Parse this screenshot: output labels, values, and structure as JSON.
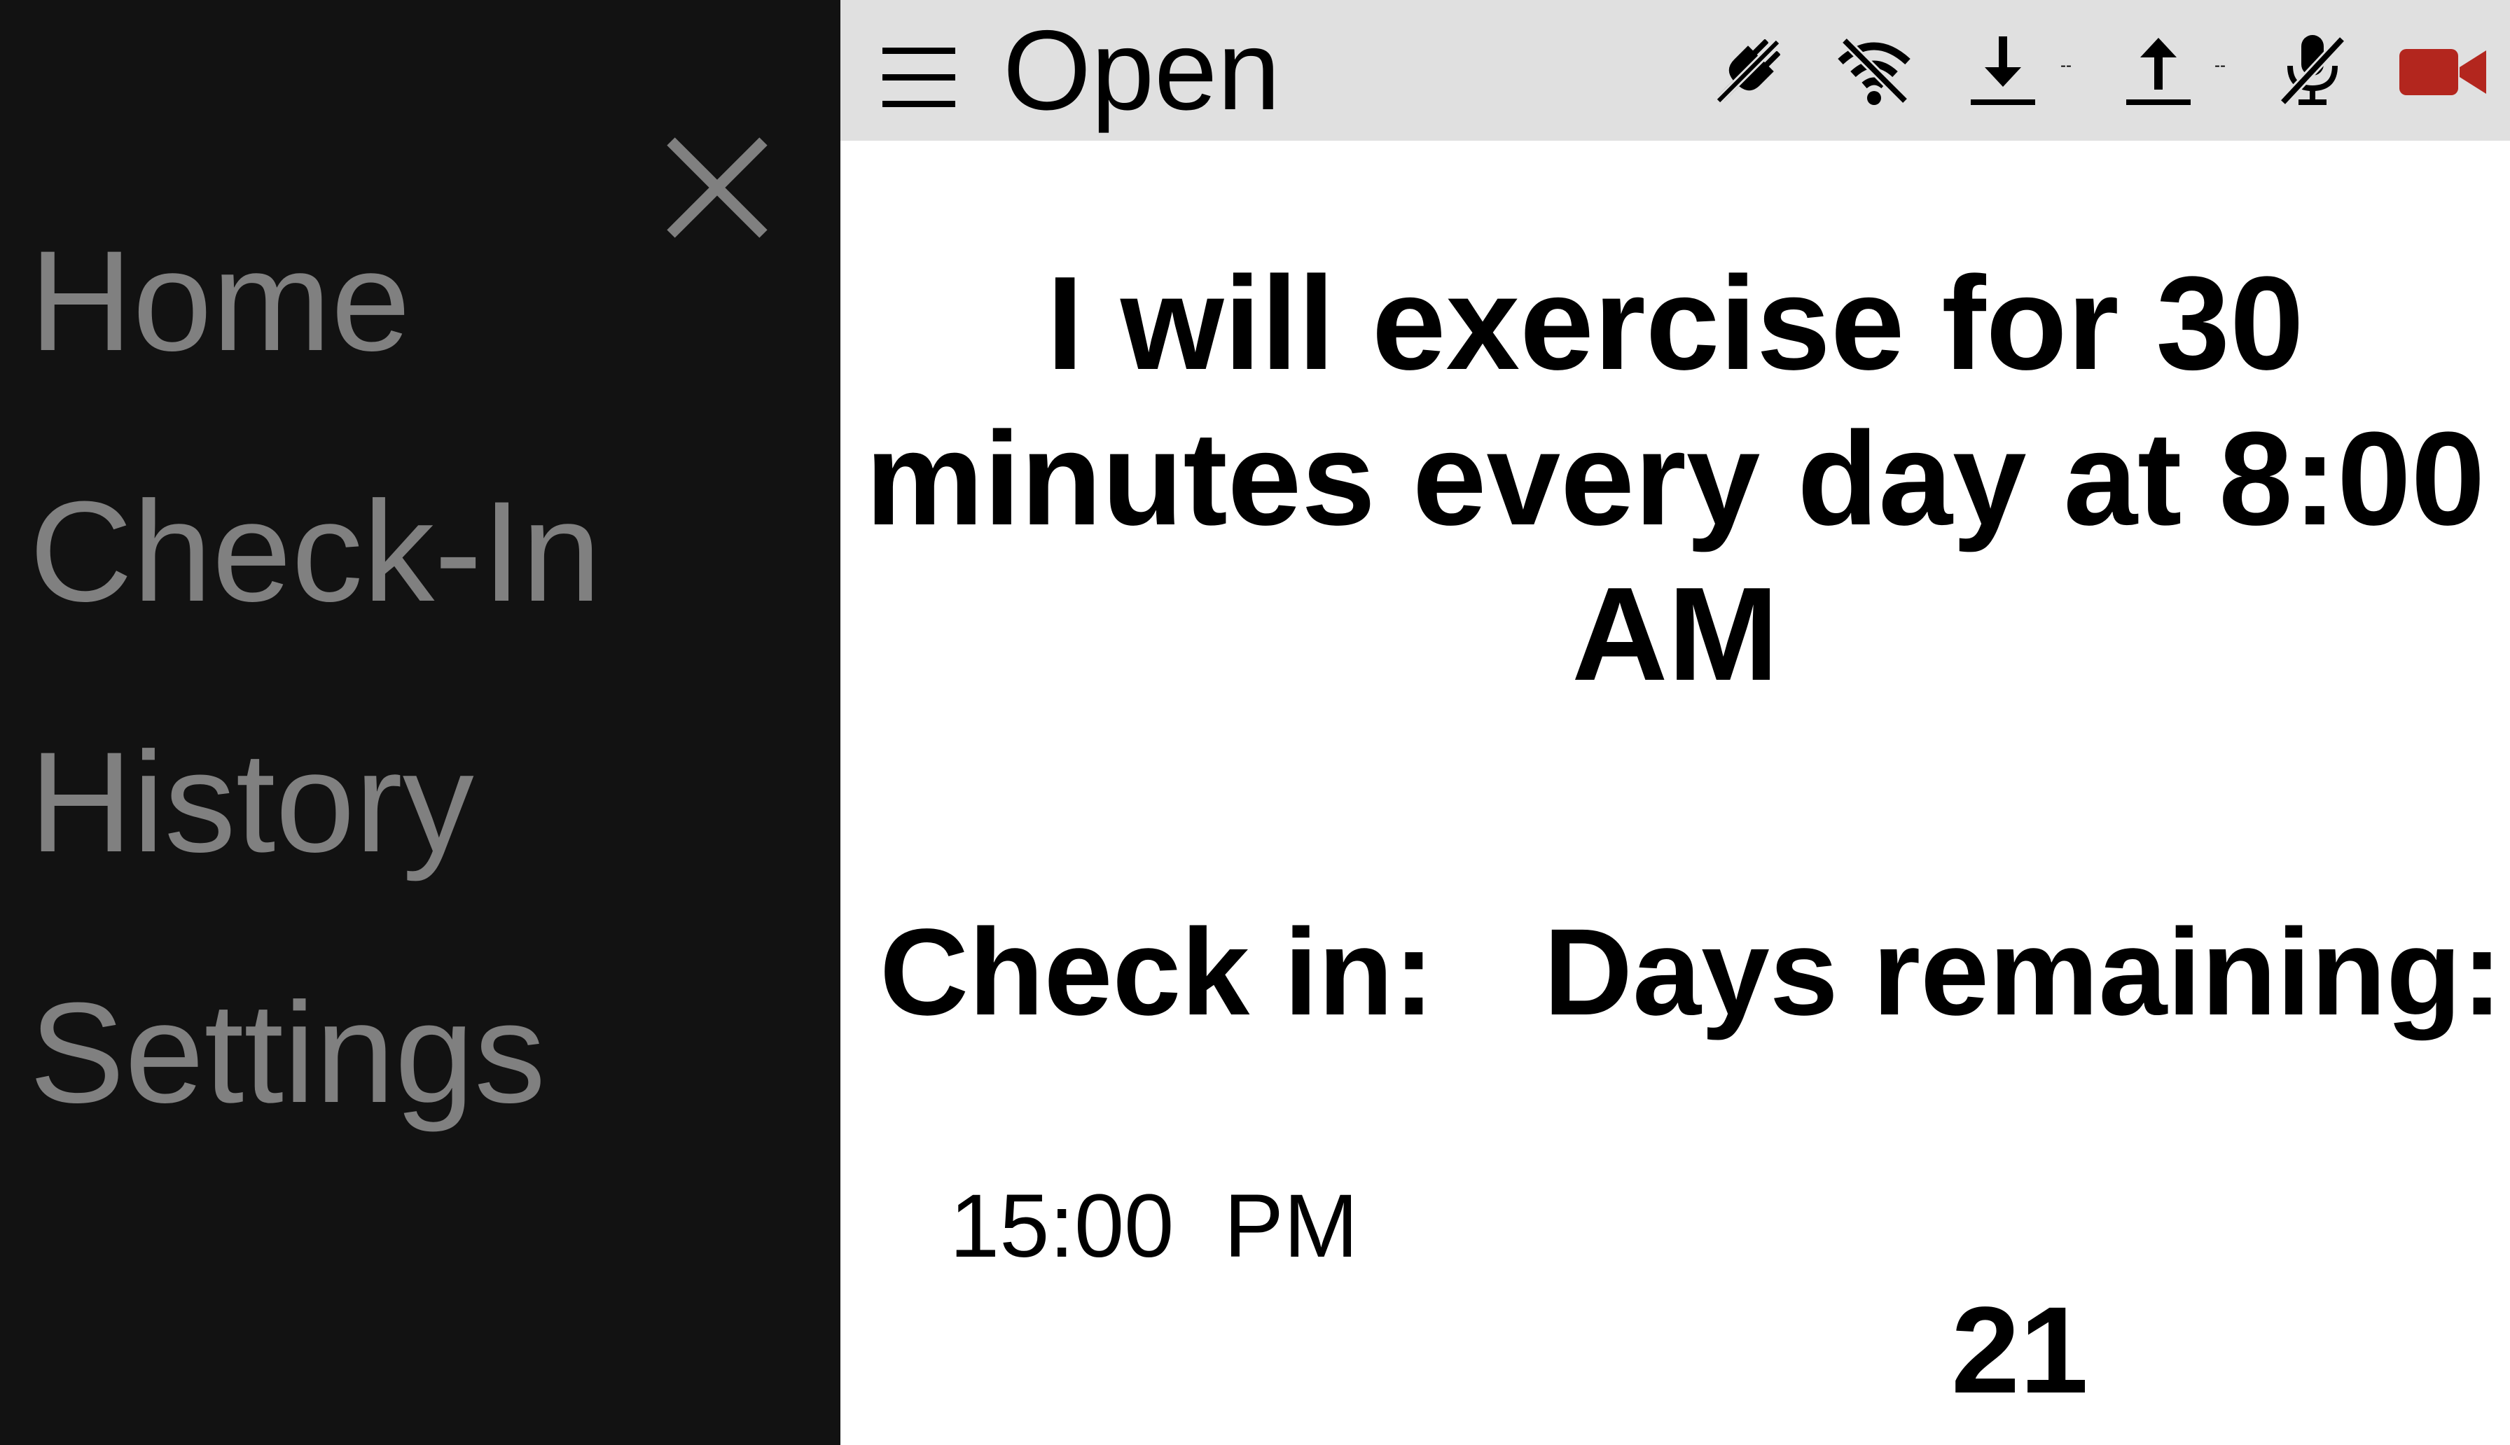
{
  "sidebar": {
    "close_icon": "close-icon",
    "items": [
      {
        "label": "Home"
      },
      {
        "label": "Check-In"
      },
      {
        "label": "History"
      },
      {
        "label": "Settings"
      }
    ],
    "text_color": "#808080",
    "background": "#121212"
  },
  "topbar": {
    "menu_icon": "hamburger-menu-icon",
    "title": "Open",
    "background": "#e0e0e0",
    "status_icons": [
      "plug-disconnected-icon",
      "wifi-off-icon",
      "download-icon",
      "upload-icon",
      "mic-off-icon",
      "video-camera-icon"
    ],
    "download_rate": "--",
    "upload_rate": "--",
    "video_icon_color": "#b3261e"
  },
  "main": {
    "goal_text": "I will exercise for 30 minutes every day at 8:00 AM",
    "checkin_label": "Check in:",
    "checkin_time": "15:00  PM",
    "days_remaining_label": "Days remaining:",
    "days_remaining_value": "21"
  }
}
